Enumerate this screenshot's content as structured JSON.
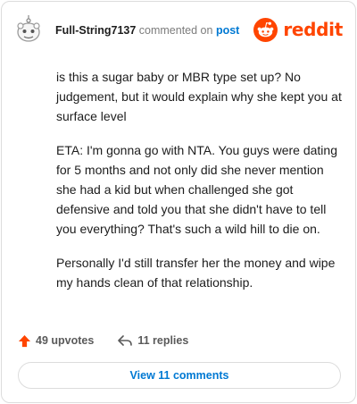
{
  "comment": {
    "author": "Full-String7137",
    "action_text": "commented on",
    "post_link": "post",
    "paragraphs": [
      "is this a sugar baby or MBR type set up? No judgement, but it would explain why she kept you at surface level",
      "ETA: I'm gonna go with NTA. You guys were dating for 5 months and not only did she never mention she had a kid but when challenged she got defensive and told you that she didn't have to tell you everything? That's such a wild hill to die on.",
      "Personally I'd still transfer her the money and wipe my hands clean of that relationship."
    ]
  },
  "brand": {
    "wordmark": "reddit",
    "icon": "reddit-logo-icon",
    "color": "#ff4500"
  },
  "actions": {
    "upvotes_label": "49 upvotes",
    "upvote_icon": "upvote-arrow-icon",
    "upvote_color": "#ff4500",
    "replies_label": "11 replies",
    "reply_icon": "reply-arrow-icon"
  },
  "view_comments_label": "View 11 comments"
}
